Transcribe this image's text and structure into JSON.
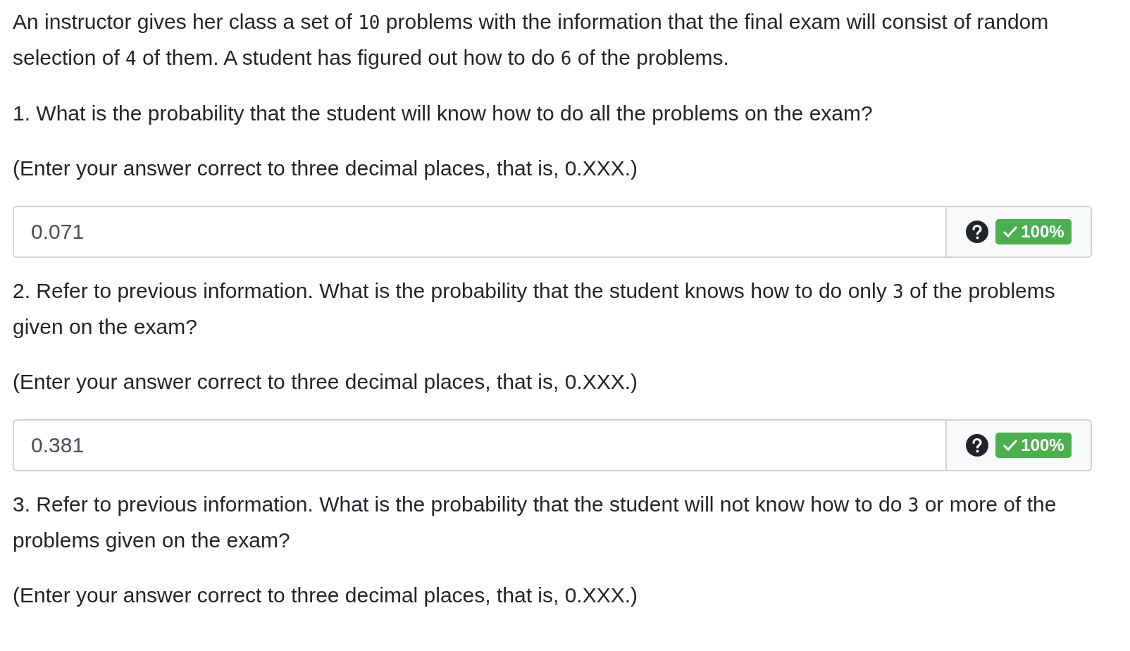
{
  "intro": [
    {
      "kind": "text",
      "text": "An instructor gives her class a set of "
    },
    {
      "kind": "math",
      "text": "10"
    },
    {
      "kind": "text",
      "text": " problems with the information that the final exam will consist of random selection of "
    },
    {
      "kind": "math",
      "text": "4"
    },
    {
      "kind": "text",
      "text": " of them. A student has figured out how to do "
    },
    {
      "kind": "math",
      "text": "6"
    },
    {
      "kind": "text",
      "text": " of the problems."
    }
  ],
  "questions": [
    {
      "prompt": [
        {
          "kind": "text",
          "text": "1. What is the probability that the student will know how to do all the problems on the exam?"
        }
      ],
      "instruction": "(Enter your answer correct to three decimal places, that is, 0.XXX.)",
      "answer": {
        "value": "0.071",
        "score": "100%",
        "correct": true
      }
    },
    {
      "prompt": [
        {
          "kind": "text",
          "text": "2. Refer to previous information. What is the probability that the student knows how to do only "
        },
        {
          "kind": "math",
          "text": "3"
        },
        {
          "kind": "text",
          "text": " of the problems given on the exam?"
        }
      ],
      "instruction": "(Enter your answer correct to three decimal places, that is, 0.XXX.)",
      "answer": {
        "value": "0.381",
        "score": "100%",
        "correct": true
      }
    },
    {
      "prompt": [
        {
          "kind": "text",
          "text": "3. Refer to previous information. What is the probability that the student will not know how to do "
        },
        {
          "kind": "math",
          "text": "3"
        },
        {
          "kind": "text",
          "text": " or more of the problems given on the exam?"
        }
      ],
      "instruction": "(Enter your answer correct to three decimal places, that is, 0.XXX.)"
    }
  ]
}
